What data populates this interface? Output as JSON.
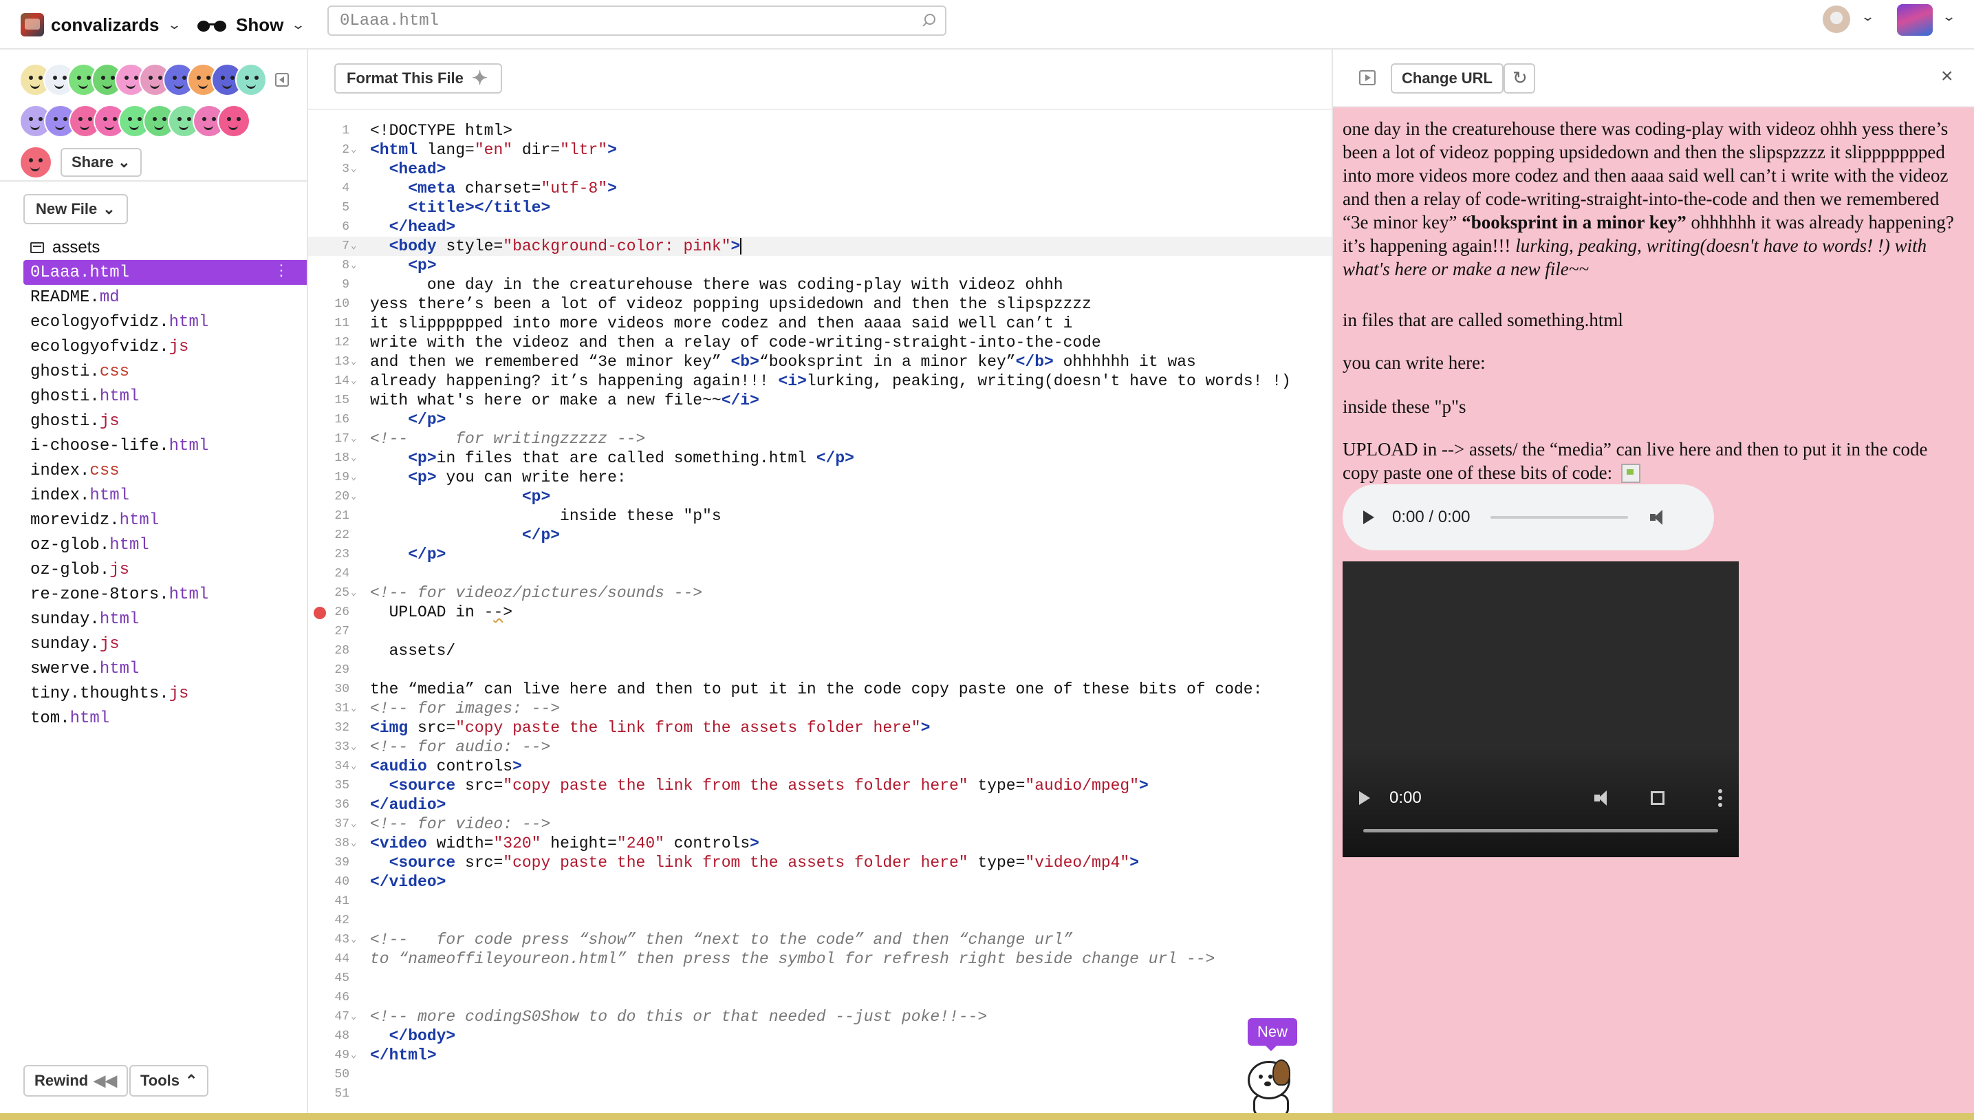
{
  "header": {
    "project_name": "convalizards",
    "show_label": "Show",
    "search_value": "0Laaa.html"
  },
  "sidebar": {
    "share_label": "Share",
    "new_file_label": "New File",
    "files": [
      {
        "name": "assets",
        "ext": "",
        "folder": true
      },
      {
        "name": "0Laaa.html",
        "ext": "",
        "active": true
      },
      {
        "name": "README.",
        "ext": "md"
      },
      {
        "name": "ecologyofvidz.",
        "ext": "html"
      },
      {
        "name": "ecologyofvidz.",
        "ext": "js"
      },
      {
        "name": "ghosti.",
        "ext": "css"
      },
      {
        "name": "ghosti.",
        "ext": "html"
      },
      {
        "name": "ghosti.",
        "ext": "js"
      },
      {
        "name": "i-choose-life.",
        "ext": "html"
      },
      {
        "name": "index.",
        "ext": "css"
      },
      {
        "name": "index.",
        "ext": "html"
      },
      {
        "name": "morevidz.",
        "ext": "html"
      },
      {
        "name": "oz-glob.",
        "ext": "html"
      },
      {
        "name": "oz-glob.",
        "ext": "js"
      },
      {
        "name": "re-zone-8tors.",
        "ext": "html"
      },
      {
        "name": "sunday.",
        "ext": "html"
      },
      {
        "name": "sunday.",
        "ext": "js"
      },
      {
        "name": "swerve.",
        "ext": "html"
      },
      {
        "name": "tiny.thoughts.",
        "ext": "js"
      },
      {
        "name": "tom.",
        "ext": "html"
      }
    ],
    "rewind_label": "Rewind",
    "tools_label": "Tools",
    "avatar_colors_row1": [
      "#f2e3a6",
      "#eaf0f5",
      "#7be07b",
      "#6fd36f",
      "#f39bd0",
      "#e79ac0",
      "#6a6ee0",
      "#f4a561",
      "#5d62d6",
      "#8fe0c8"
    ],
    "avatar_colors_row2": [
      "#b9a7f0",
      "#9d8bef",
      "#ef6aa2",
      "#f06fb0",
      "#76e28a",
      "#70d980",
      "#86e0a0",
      "#ec79b8",
      "#f05a8f"
    ],
    "avatar_colors_row3": [
      "#f06a7a"
    ]
  },
  "editor": {
    "format_label": "Format This File",
    "new_badge": "New",
    "lines": [
      {
        "n": "1",
        "html": "<span class=\"txt\">&lt;!DOCTYPE html&gt;</span>"
      },
      {
        "n": "2",
        "fold": true,
        "html": "<span class=\"tag\">&lt;html</span> <span class=\"attr\">lang=</span><span class=\"str\">\"en\"</span> <span class=\"attr\">dir=</span><span class=\"str\">\"ltr\"</span><span class=\"tag\">&gt;</span>"
      },
      {
        "n": "3",
        "fold": true,
        "html": "  <span class=\"tag\">&lt;head&gt;</span>"
      },
      {
        "n": "4",
        "html": "    <span class=\"tag\">&lt;meta</span> <span class=\"attr\">charset=</span><span class=\"str\">\"utf-8\"</span><span class=\"tag\">&gt;</span>"
      },
      {
        "n": "5",
        "html": "    <span class=\"tag\">&lt;title&gt;&lt;/title&gt;</span>"
      },
      {
        "n": "6",
        "html": "  <span class=\"tag\">&lt;/head&gt;</span>"
      },
      {
        "n": "7",
        "fold": true,
        "active": true,
        "html": "  <span class=\"tag\">&lt;body</span> <span class=\"attr\">style=</span><span class=\"str\">\"background-color: pink\"</span><span class=\"tag\">&gt;</span><span class=\"caret\"></span>"
      },
      {
        "n": "8",
        "fold": true,
        "html": "    <span class=\"tag\">&lt;p&gt;</span>"
      },
      {
        "n": "9",
        "html": "      <span class=\"txt\">one day in the creaturehouse there was coding-play with videoz ohhh</span>"
      },
      {
        "n": "10",
        "html": "<span class=\"txt\">yess there’s been a lot of videoz popping upsidedown and then the slipspzzzz</span>"
      },
      {
        "n": "11",
        "html": "<span class=\"txt\">it slipppppped into more videos more codez and then aaaa said well can’t i</span>"
      },
      {
        "n": "12",
        "html": "<span class=\"txt\">write with the videoz and then a relay of code-writing-straight-into-the-code</span>"
      },
      {
        "n": "13",
        "fold": true,
        "html": "<span class=\"txt\">and then we remembered “3e minor key” </span><span class=\"tag\">&lt;b&gt;</span><span class=\"txt\">“booksprint in a minor key”</span><span class=\"tag\">&lt;/b&gt;</span><span class=\"txt\"> ohhhhhh it was</span>"
      },
      {
        "n": "14",
        "fold": true,
        "html": "<span class=\"txt\">already happening? it’s happening again!!! </span><span class=\"tag\">&lt;i&gt;</span><span class=\"txt\">lurking, peaking, writing(doesn't have to words! !)</span>"
      },
      {
        "n": "15",
        "html": "<span class=\"txt\">with what's here or make a new file~~</span><span class=\"tag\">&lt;/i&gt;</span>"
      },
      {
        "n": "16",
        "html": "    <span class=\"tag\">&lt;/p&gt;</span>"
      },
      {
        "n": "17",
        "fold": true,
        "html": "<span class=\"cmt\">&lt;!--     for writingzzzzz --&gt;</span>"
      },
      {
        "n": "18",
        "fold": true,
        "html": "    <span class=\"tag\">&lt;p&gt;</span><span class=\"txt\">in files that are called something.html </span><span class=\"tag\">&lt;/p&gt;</span>"
      },
      {
        "n": "19",
        "fold": true,
        "html": "    <span class=\"tag\">&lt;p&gt;</span><span class=\"txt\"> you can write here:</span>"
      },
      {
        "n": "20",
        "fold": true,
        "html": "                <span class=\"tag\">&lt;p&gt;</span>"
      },
      {
        "n": "21",
        "html": "                    <span class=\"txt\">inside these \"p\"s</span>"
      },
      {
        "n": "22",
        "html": "                <span class=\"tag\">&lt;/p&gt;</span>"
      },
      {
        "n": "23",
        "html": "    <span class=\"tag\">&lt;/p&gt;</span>"
      },
      {
        "n": "24",
        "html": ""
      },
      {
        "n": "25",
        "fold": true,
        "html": "<span class=\"cmt\">&lt;!-- for videoz/pictures/sounds --&gt;</span>"
      },
      {
        "n": "26",
        "breakpoint": true,
        "html": "  <span class=\"txt\">UPLOAD in -</span><span class=\"txt squiggle\">-</span><span class=\"txt\">&gt;</span>"
      },
      {
        "n": "27",
        "html": ""
      },
      {
        "n": "28",
        "html": "  <span class=\"txt\">assets/</span>"
      },
      {
        "n": "29",
        "html": ""
      },
      {
        "n": "30",
        "html": "<span class=\"txt\">the “media” can live here and then to put it in the code copy paste one of these bits of code:</span>"
      },
      {
        "n": "31",
        "fold": true,
        "html": "<span class=\"cmt\">&lt;!-- for images: --&gt;</span>"
      },
      {
        "n": "32",
        "html": "<span class=\"tag\">&lt;img</span> <span class=\"attr\">src=</span><span class=\"str\">\"copy paste the link from the assets folder here\"</span><span class=\"tag\">&gt;</span>"
      },
      {
        "n": "33",
        "fold": true,
        "html": "<span class=\"cmt\">&lt;!-- for audio: --&gt;</span>"
      },
      {
        "n": "34",
        "fold": true,
        "html": "<span class=\"tag\">&lt;audio</span> <span class=\"attr\">controls</span><span class=\"tag\">&gt;</span>"
      },
      {
        "n": "35",
        "html": "  <span class=\"tag\">&lt;source</span> <span class=\"attr\">src=</span><span class=\"str\">\"copy paste the link from the assets folder here\"</span> <span class=\"attr\">type=</span><span class=\"str\">\"audio/mpeg\"</span><span class=\"tag\">&gt;</span>"
      },
      {
        "n": "36",
        "html": "<span class=\"tag\">&lt;/audio&gt;</span>"
      },
      {
        "n": "37",
        "fold": true,
        "html": "<span class=\"cmt\">&lt;!-- for video: --&gt;</span>"
      },
      {
        "n": "38",
        "fold": true,
        "html": "<span class=\"tag\">&lt;video</span> <span class=\"attr\">width=</span><span class=\"str\">\"320\"</span> <span class=\"attr\">height=</span><span class=\"str\">\"240\"</span> <span class=\"attr\">controls</span><span class=\"tag\">&gt;</span>"
      },
      {
        "n": "39",
        "html": "  <span class=\"tag\">&lt;source</span> <span class=\"attr\">src=</span><span class=\"str\">\"copy paste the link from the assets folder here\"</span> <span class=\"attr\">type=</span><span class=\"str\">\"video/mp4\"</span><span class=\"tag\">&gt;</span>"
      },
      {
        "n": "40",
        "html": "<span class=\"tag\">&lt;/video&gt;</span>"
      },
      {
        "n": "41",
        "html": ""
      },
      {
        "n": "42",
        "html": ""
      },
      {
        "n": "43",
        "fold": true,
        "html": "<span class=\"cmt\">&lt;!--   for code press “show” then “next to the code” and then “change url”</span>"
      },
      {
        "n": "44",
        "html": "<span class=\"cmt\">to “nameoffileyoureon.html” then press the symbol for refresh right beside change url --&gt;</span>"
      },
      {
        "n": "45",
        "html": ""
      },
      {
        "n": "46",
        "html": ""
      },
      {
        "n": "47",
        "fold": true,
        "html": "<span class=\"cmt\">&lt;!-- more codingS0Show to do this or that needed --just poke!!--&gt;</span>"
      },
      {
        "n": "48",
        "html": "  <span class=\"tag\">&lt;/body&gt;</span>"
      },
      {
        "n": "49",
        "fold": true,
        "html": "<span class=\"tag\">&lt;/html&gt;</span>"
      },
      {
        "n": "50",
        "html": ""
      },
      {
        "n": "51",
        "html": ""
      }
    ]
  },
  "preview": {
    "change_url_label": "Change URL",
    "p1_a": "one day in the creaturehouse there was coding-play with videoz ohhh yess there’s been a lot of videoz popping upsidedown and then the slipspzzzz it slippppppped into more videos more codez and then aaaa said well can’t i write with the videoz and then a relay of code-writing-straight-into-the-code and then we remembered “3e minor key” ",
    "p1_b": "“booksprint in a minor key”",
    "p1_c": " ohhhhhh it was already happening? it’s happening again!!! ",
    "p1_i": "lurking, peaking, writing(doesn't have to words! !) with what's here or make a new file~~",
    "p2": "in files that are called something.html",
    "p3": "you can write here:",
    "p4": "inside these \"p\"s",
    "upload_text": "UPLOAD in --> assets/ the “media” can live here and then to put it in the code copy paste one of these bits of code:",
    "audio_time": "0:00 / 0:00",
    "video_time": "0:00"
  }
}
